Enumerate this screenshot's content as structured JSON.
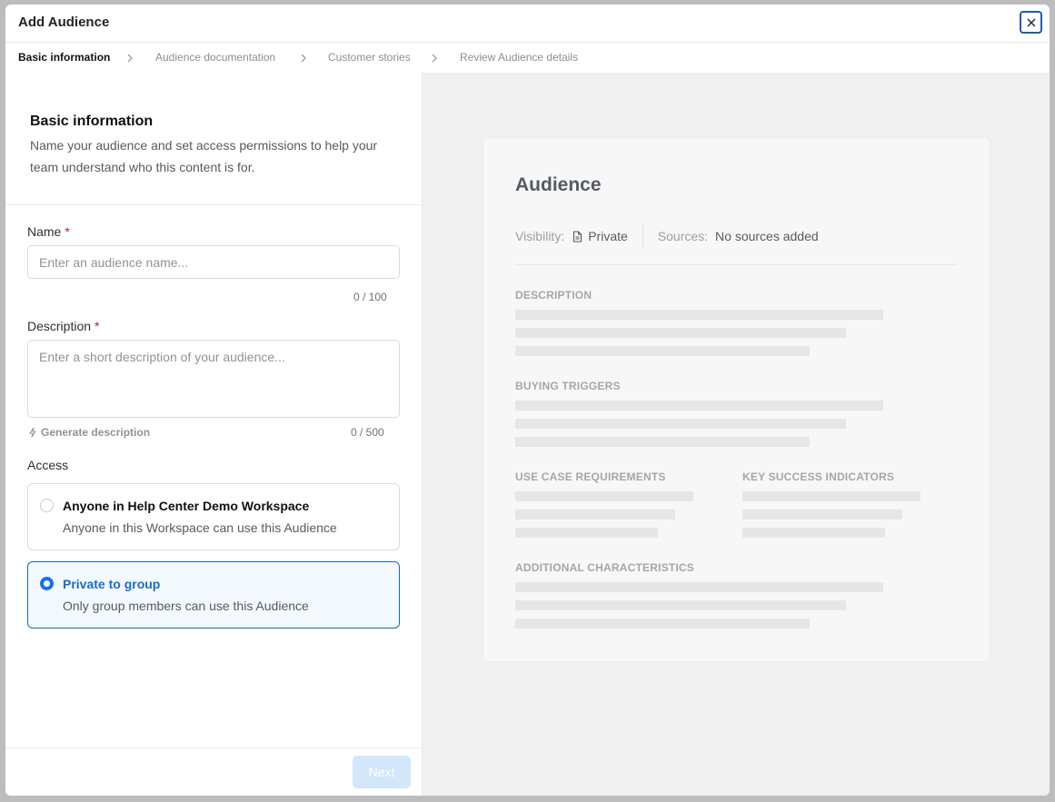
{
  "dialog": {
    "title": "Add Audience",
    "close_icon": "close-icon"
  },
  "steps": [
    {
      "label": "Basic information",
      "active": true
    },
    {
      "label": "Audience documentation",
      "active": false
    },
    {
      "label": "Customer stories",
      "active": false
    },
    {
      "label": "Review Audience details",
      "active": false
    }
  ],
  "form": {
    "heading": "Basic information",
    "subheading": "Name your audience and set access permissions to help your team understand who this content is for.",
    "name": {
      "label": "Name",
      "required_mark": "*",
      "placeholder": "Enter an audience name...",
      "value": "",
      "counter": "0 / 100"
    },
    "description": {
      "label": "Description",
      "required_mark": "*",
      "placeholder": "Enter a short description of your audience...",
      "value": "",
      "counter": "0 / 500",
      "generate_label": "Generate description",
      "generate_icon": "lightning-icon"
    },
    "access": {
      "label": "Access",
      "options": [
        {
          "title": "Anyone in Help Center Demo Workspace",
          "subtitle": "Anyone in this Workspace can use this Audience",
          "selected": false
        },
        {
          "title": "Private to group",
          "subtitle": "Only group members can use this Audience",
          "selected": true
        }
      ]
    },
    "next_label": "Next"
  },
  "preview": {
    "title": "Audience",
    "visibility_label": "Visibility:",
    "visibility_value": "Private",
    "visibility_icon": "document-icon",
    "sources_label": "Sources:",
    "sources_value": "No sources added",
    "sections": {
      "description": "DESCRIPTION",
      "buying_triggers": "BUYING TRIGGERS",
      "use_case_requirements": "USE CASE REQUIREMENTS",
      "key_success_indicators": "KEY SUCCESS INDICATORS",
      "additional_characteristics": "ADDITIONAL CHARACTERISTICS"
    }
  },
  "colors": {
    "accent": "#1570ef",
    "required": "#c4122f",
    "next_disabled_bg": "#d3e6fa",
    "preview_bg": "#f0f0f0"
  }
}
